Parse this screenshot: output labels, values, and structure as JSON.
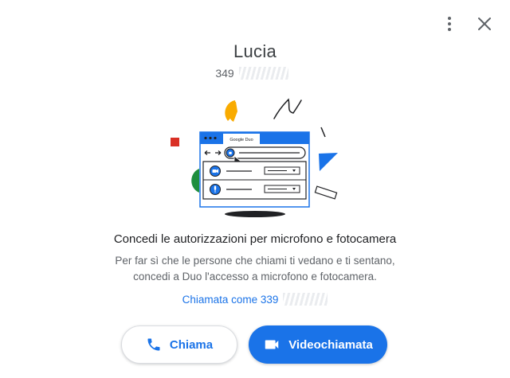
{
  "header": {
    "more_icon": "more-vert-icon",
    "close_icon": "close-icon"
  },
  "contact": {
    "name": "Lucia",
    "phone_visible": "349"
  },
  "illustration": {
    "browser_tab_label": "Google Duo"
  },
  "permission": {
    "headline": "Concedi le autorizzazioni per microfono e fotocamera",
    "description_line1": "Per far sì che le persone che chiami ti vedano e ti sentano,",
    "description_line2": "concedi a Duo l'accesso a microfono e fotocamera.",
    "calling_as_prefix": "Chiamata come 339"
  },
  "actions": {
    "voice_call_label": "Chiama",
    "video_call_label": "Videochiamata",
    "voice_icon": "phone-icon",
    "video_icon": "videocam-icon"
  },
  "colors": {
    "accent": "#1a73e8",
    "yellow": "#f9ab00",
    "red": "#d93025",
    "green": "#1e8e3e"
  }
}
